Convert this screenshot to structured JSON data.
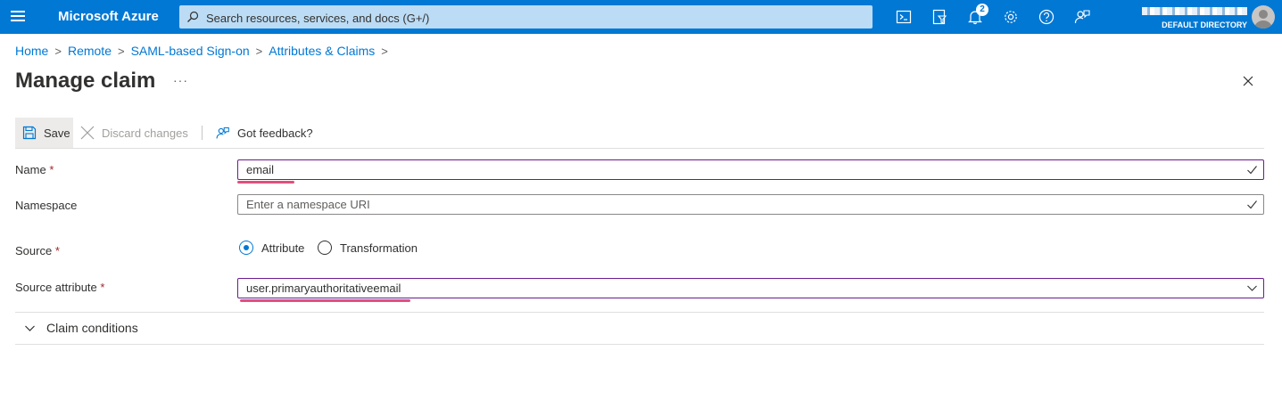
{
  "header": {
    "brand": "Microsoft Azure",
    "search_placeholder": "Search resources, services, and docs (G+/)",
    "notification_count": "2",
    "directory": "DEFAULT DIRECTORY",
    "icons": [
      "cloud-shell-icon",
      "directory-filter-icon",
      "bell-icon",
      "gear-icon",
      "help-icon",
      "feedback-icon"
    ]
  },
  "breadcrumb": [
    "Home",
    "Remote",
    "SAML-based Sign-on",
    "Attributes & Claims"
  ],
  "page": {
    "title": "Manage claim",
    "more": "···"
  },
  "toolbar": {
    "save_label": "Save",
    "discard_label": "Discard changes",
    "feedback_label": "Got feedback?"
  },
  "form": {
    "name_label": "Name",
    "name_value": "email",
    "namespace_label": "Namespace",
    "namespace_placeholder": "Enter a namespace URI",
    "source_label": "Source",
    "source_options": [
      "Attribute",
      "Transformation"
    ],
    "source_selected": "Attribute",
    "source_attribute_label": "Source attribute",
    "source_attribute_value": "user.primaryauthoritativeemail",
    "required_marker": "*"
  },
  "conditions": {
    "label": "Claim conditions"
  },
  "colors": {
    "brand_blue": "#0078d4",
    "focus_border": "#6b1a8f",
    "highlight": "#e0507e",
    "required": "#a4262c"
  }
}
